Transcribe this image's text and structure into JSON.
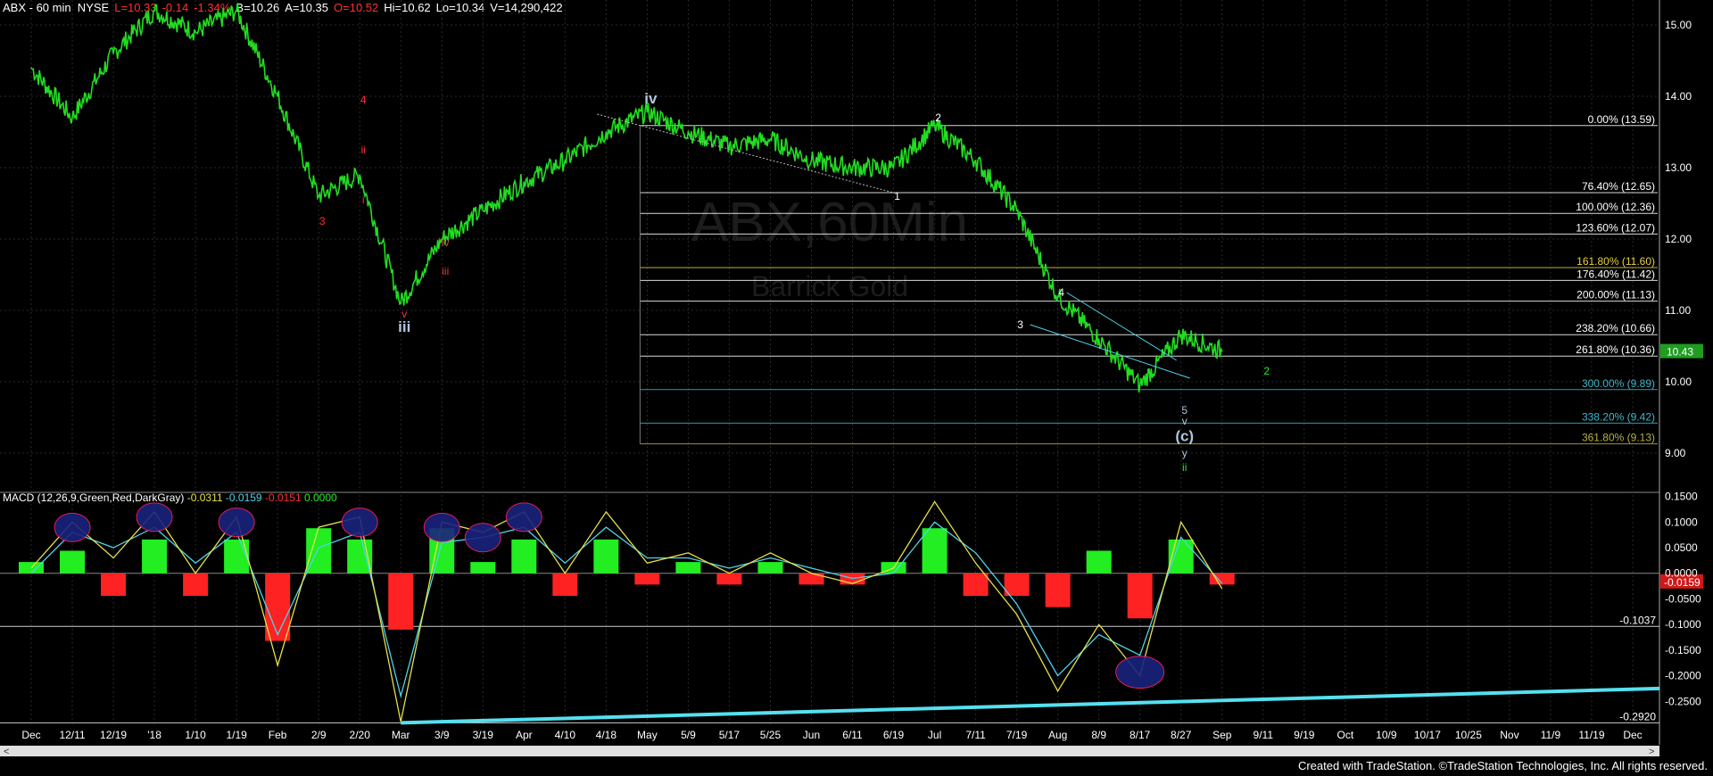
{
  "header": {
    "symbol": "ABX - 60 min  NYSE",
    "last": "L=10.33",
    "change": "-0.14",
    "change_pct": "-1.34%",
    "bid": "B=10.26",
    "ask": "A=10.35",
    "open": "O=10.52",
    "high": "Hi=10.62",
    "low": "Lo=10.34",
    "volume": "V=14,290,422"
  },
  "watermark": {
    "symbol": "ABX,60Min",
    "name": "Barrick Gold"
  },
  "footer": "Created with TradeStation. ©TradeStation Technologies, Inc. All rights reserved.",
  "colors": {
    "price": "#22dd22",
    "macd": "#e6e04a",
    "signal": "#4fd3e8",
    "hist_pos": "#22ee22",
    "hist_neg": "#ff2222",
    "trend": "#55e0f0",
    "ellipse": "#1a237e",
    "ellipse_border": "#ff2060"
  },
  "macd_header": {
    "title": "MACD (12,26,9,Green,Red,DarkGray)",
    "macd": "-0.0311",
    "signal": "-0.0159",
    "diff": "-0.0151",
    "zero": "0.0000"
  },
  "chart_data": [
    {
      "type": "line",
      "title": "ABX - 60 min",
      "ylim": [
        8.5,
        15.35
      ],
      "y_ticks": [
        "15.00",
        "14.00",
        "13.00",
        "12.00",
        "11.00",
        "10.00",
        "9.00"
      ],
      "last_value": "10.43",
      "x_tick_labels": [
        "Dec",
        "12/11",
        "12/19",
        "'18",
        "1/10",
        "1/19",
        "Feb",
        "2/9",
        "2/20",
        "Mar",
        "3/9",
        "3/19",
        "Apr",
        "4/10",
        "4/18",
        "May",
        "5/9",
        "5/17",
        "5/25",
        "Jun",
        "6/11",
        "6/19",
        "Jul",
        "7/11",
        "7/19",
        "Aug",
        "8/9",
        "8/17",
        "8/27",
        "Sep",
        "9/11",
        "9/19",
        "Oct",
        "10/9",
        "10/17",
        "10/25",
        "Nov",
        "11/9",
        "11/19",
        "Dec"
      ],
      "series": [
        {
          "values": [
            {
              "x": "Dec",
              "y": 14.4
            },
            {
              "x": "12/11",
              "y": 13.7
            },
            {
              "x": "12/19",
              "y": 14.6
            },
            {
              "x": "'18",
              "y": 15.2
            },
            {
              "x": "1/10",
              "y": 14.9
            },
            {
              "x": "1/19",
              "y": 15.2
            },
            {
              "x": "Feb",
              "y": 14.0
            },
            {
              "x": "2/9",
              "y": 12.6
            },
            {
              "x": "2/20",
              "y": 12.9
            },
            {
              "x": "Mar",
              "y": 11.1
            },
            {
              "x": "3/9",
              "y": 12.0
            },
            {
              "x": "3/19",
              "y": 12.4
            },
            {
              "x": "Apr",
              "y": 12.8
            },
            {
              "x": "4/10",
              "y": 13.1
            },
            {
              "x": "4/18",
              "y": 13.5
            },
            {
              "x": "May",
              "y": 13.78
            },
            {
              "x": "5/9",
              "y": 13.5
            },
            {
              "x": "5/17",
              "y": 13.3
            },
            {
              "x": "5/25",
              "y": 13.4
            },
            {
              "x": "Jun",
              "y": 13.1
            },
            {
              "x": "6/11",
              "y": 13.0
            },
            {
              "x": "6/19",
              "y": 13.0
            },
            {
              "x": "Jul",
              "y": 13.59
            },
            {
              "x": "7/11",
              "y": 13.1
            },
            {
              "x": "7/19",
              "y": 12.4
            },
            {
              "x": "Aug",
              "y": 11.2
            },
            {
              "x": "8/9",
              "y": 10.6
            },
            {
              "x": "8/17",
              "y": 9.95
            },
            {
              "x": "8/27",
              "y": 10.66
            },
            {
              "x": "Sep",
              "y": 10.43
            }
          ]
        }
      ],
      "fib_levels": [
        {
          "label": "0.00% (13.59)",
          "value": 13.59,
          "color": "#ffffff"
        },
        {
          "label": "76.40% (12.65)",
          "value": 12.65,
          "color": "#ffffff"
        },
        {
          "label": "100.00% (12.36)",
          "value": 12.36,
          "color": "#ffffff"
        },
        {
          "label": "123.60% (12.07)",
          "value": 12.07,
          "color": "#ffffff"
        },
        {
          "label": "161.80% (11.60)",
          "value": 11.6,
          "color": "#e8d040"
        },
        {
          "label": "176.40% (11.42)",
          "value": 11.42,
          "color": "#ffffff"
        },
        {
          "label": "200.00% (11.13)",
          "value": 11.13,
          "color": "#ffffff"
        },
        {
          "label": "238.20% (10.66)",
          "value": 10.66,
          "color": "#ffffff"
        },
        {
          "label": "261.80% (10.36)",
          "value": 10.36,
          "color": "#ffffff"
        },
        {
          "label": "300.00% (9.89)",
          "value": 9.89,
          "color": "#3fb6c8"
        },
        {
          "label": "338.20% (9.42)",
          "value": 9.42,
          "color": "#3fb6c8"
        },
        {
          "label": "361.80% (9.13)",
          "value": 9.13,
          "color": "#b8b040"
        }
      ],
      "wave_labels": [
        {
          "text": "iv",
          "x": "May",
          "y": 13.9,
          "color": "#b0c4de"
        },
        {
          "text": "iii",
          "x": "Mar",
          "y": 10.7,
          "color": "#b0c4de"
        },
        {
          "text": "4",
          "x": "2/20",
          "y": 13.9,
          "color": "#ff3030"
        },
        {
          "text": "ii",
          "x": "2/20",
          "y": 13.2,
          "color": "#ff3030"
        },
        {
          "text": "i",
          "x": "2/20",
          "y": 12.5,
          "color": "#ff3030"
        },
        {
          "text": "3",
          "x": "2/9",
          "y": 12.2,
          "color": "#ff3030"
        },
        {
          "text": "iv",
          "x": "3/9",
          "y": 11.9,
          "color": "#ff3030"
        },
        {
          "text": "iii",
          "x": "3/9",
          "y": 11.5,
          "color": "#ff3030"
        },
        {
          "text": "v",
          "x": "Mar",
          "y": 10.9,
          "color": "#ff3030"
        },
        {
          "text": "1",
          "x": "6/19",
          "y": 12.55,
          "color": "#ffffff"
        },
        {
          "text": "2",
          "x": "Jul",
          "y": 13.65,
          "color": "#ffffff"
        },
        {
          "text": "3",
          "x": "7/19",
          "y": 10.75,
          "color": "#ffffff"
        },
        {
          "text": "4",
          "x": "Aug",
          "y": 11.2,
          "color": "#ffffff"
        },
        {
          "text": "2",
          "x": "9/11",
          "y": 10.1,
          "color": "#22ee22"
        },
        {
          "text": "5",
          "x": "8/27",
          "y": 9.55,
          "color": "#b0c4de"
        },
        {
          "text": "v",
          "x": "8/27",
          "y": 9.4,
          "color": "#b0c4de"
        },
        {
          "text": "(c)",
          "x": "8/27",
          "y": 9.17,
          "color": "#b0c4de"
        },
        {
          "text": "y",
          "x": "8/27",
          "y": 8.95,
          "color": "#b0c4de"
        },
        {
          "text": "ii",
          "x": "8/27",
          "y": 8.75,
          "color": "#22ee22"
        }
      ]
    },
    {
      "type": "line",
      "title": "MACD (12,26,9,Green,Red,DarkGray)",
      "ylim": [
        -0.3,
        0.165
      ],
      "y_ticks": [
        "0.1500",
        "0.1000",
        "0.0500",
        "0.0000",
        "-0.0500",
        "-0.1000",
        "-0.1500",
        "-0.2000",
        "-0.2500"
      ],
      "reference_lines": [
        {
          "label": "-0.1037",
          "value": -0.1037
        },
        {
          "label": "-0.2920",
          "value": -0.292
        }
      ],
      "last_value": "-0.0159",
      "series": [
        {
          "name": "MACD",
          "values": [
            0.01,
            0.1,
            0.03,
            0.12,
            0.0,
            0.11,
            -0.18,
            0.09,
            0.11,
            -0.29,
            0.1,
            0.08,
            0.12,
            0.0,
            0.12,
            0.02,
            0.04,
            0.0,
            0.04,
            0.0,
            -0.02,
            0.01,
            0.14,
            0.02,
            -0.08,
            -0.23,
            -0.1,
            -0.2,
            0.1,
            -0.03
          ]
        },
        {
          "name": "Signal",
          "values": [
            0.0,
            0.08,
            0.05,
            0.09,
            0.02,
            0.08,
            -0.12,
            0.05,
            0.08,
            -0.24,
            0.06,
            0.07,
            0.09,
            0.02,
            0.09,
            0.03,
            0.03,
            0.01,
            0.03,
            0.01,
            -0.01,
            0.0,
            0.1,
            0.04,
            -0.06,
            -0.2,
            -0.12,
            -0.16,
            0.07,
            -0.02
          ]
        }
      ]
    }
  ]
}
